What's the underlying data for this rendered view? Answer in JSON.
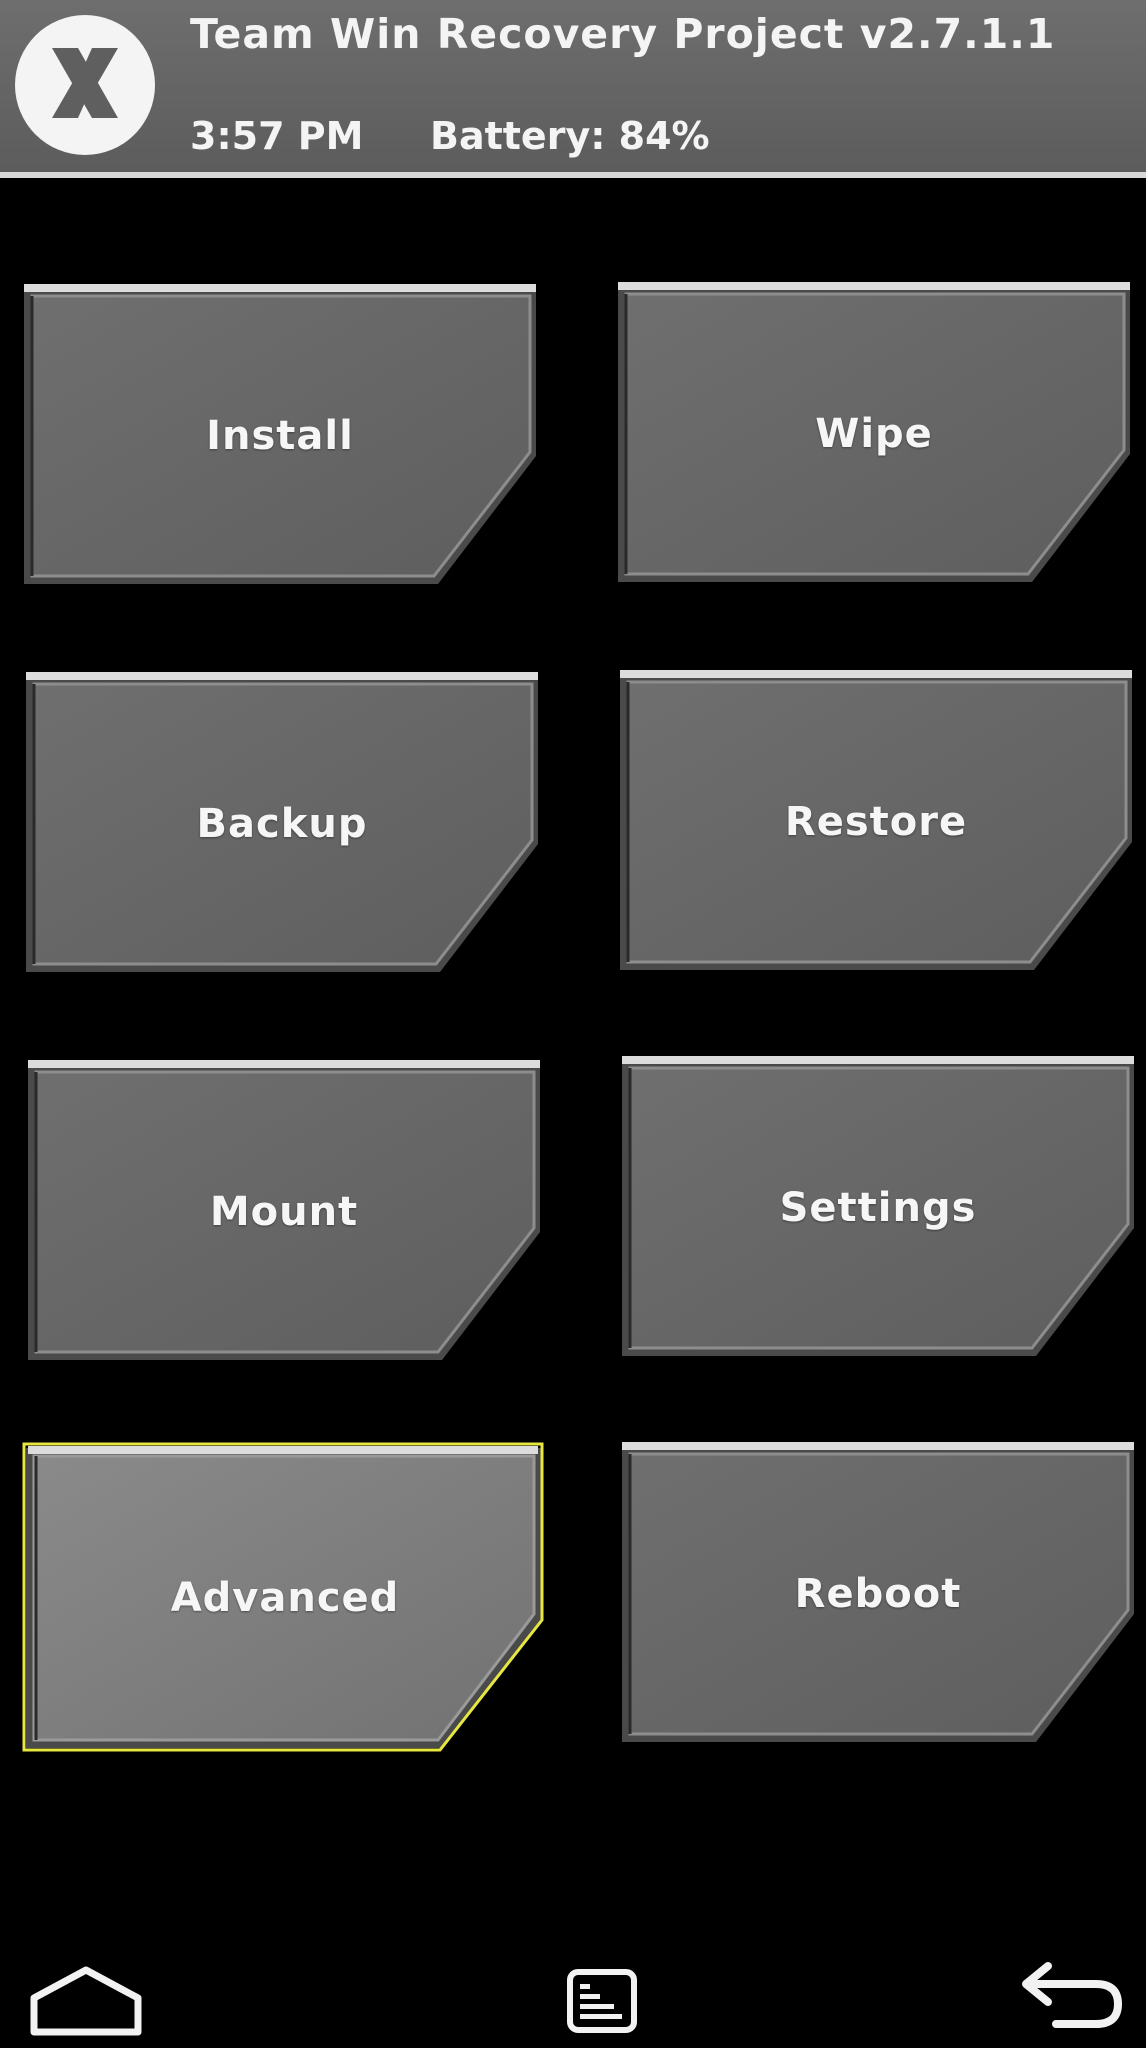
{
  "header": {
    "title": "Team Win Recovery Project  v2.7.1.1",
    "time": "3:57 PM",
    "battery": "Battery: 84%",
    "logo_icon": "twrp-logo-icon"
  },
  "menu": {
    "install": "Install",
    "wipe": "Wipe",
    "backup": "Backup",
    "restore": "Restore",
    "mount": "Mount",
    "settings": "Settings",
    "advanced": "Advanced",
    "reboot": "Reboot",
    "focused_item": "advanced"
  },
  "navbar": {
    "home_icon": "home-icon",
    "console_icon": "console-icon",
    "back_icon": "back-arrow-icon"
  },
  "colors": {
    "background": "#000000",
    "header": "#666666",
    "tile_fill": "#6a6a6a",
    "tile_border": "#cfcfcf",
    "focus": "#e8e640"
  }
}
